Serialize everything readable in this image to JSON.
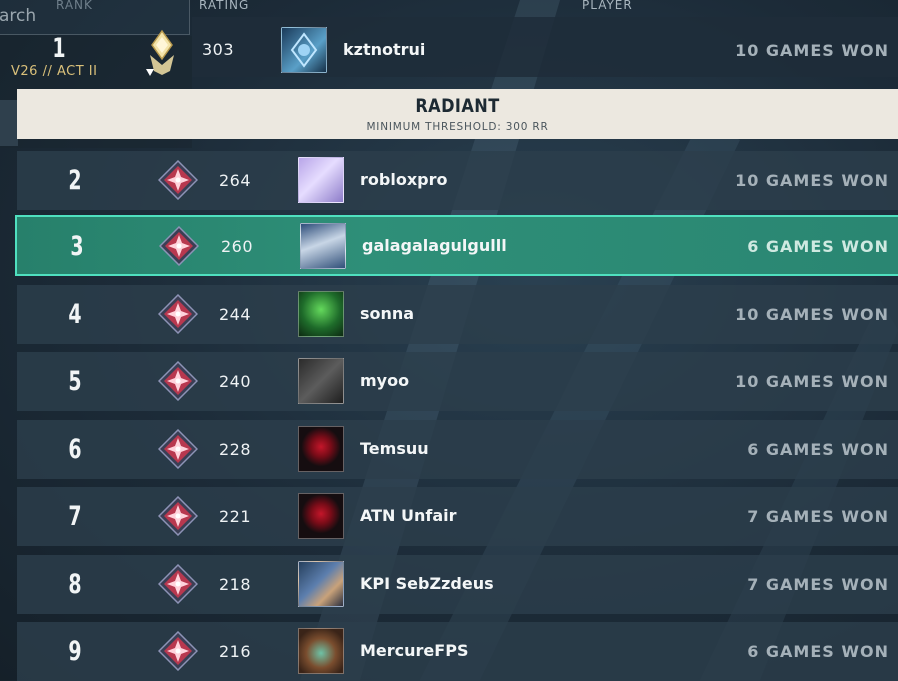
{
  "columns": {
    "rank": "RANK",
    "rating": "RATING",
    "player": "PLAYER"
  },
  "search": {
    "placeholder": "arch"
  },
  "season": "V26 // ACT II",
  "tier_banner": {
    "title": "RADIANT",
    "subtitle": "MINIMUM THRESHOLD: 300 RR"
  },
  "colors": {
    "selected_row": "#2e8f78",
    "selected_border": "#4fe0bf",
    "banner": "#ece8e0",
    "row": "#2c3e4c"
  },
  "rows": [
    {
      "rank": "1",
      "rating": "303",
      "name": "kztnotrui",
      "games": "10 GAMES WON",
      "tier_icon": "radiant-rank-icon",
      "avatar": "card-blue-emblem"
    },
    {
      "rank": "2",
      "rating": "264",
      "name": "robloxpro",
      "games": "10 GAMES WON",
      "tier_icon": "immortal-rank-icon",
      "avatar": "card-lilac-figure"
    },
    {
      "rank": "3",
      "rating": "260",
      "name": "galagalagulgulll",
      "games": "6 GAMES WON",
      "tier_icon": "immortal-rank-icon",
      "avatar": "card-white-hair-agent",
      "selected": true
    },
    {
      "rank": "4",
      "rating": "244",
      "name": "sonna",
      "games": "10 GAMES WON",
      "tier_icon": "immortal-rank-icon",
      "avatar": "card-green-silhouette"
    },
    {
      "rank": "5",
      "rating": "240",
      "name": "myoo",
      "games": "10 GAMES WON",
      "tier_icon": "immortal-rank-icon",
      "avatar": "card-grey-logo"
    },
    {
      "rank": "6",
      "rating": "228",
      "name": "Temsuu",
      "games": "6 GAMES WON",
      "tier_icon": "immortal-rank-icon",
      "avatar": "card-red-rose"
    },
    {
      "rank": "7",
      "rating": "221",
      "name": "ATN Unfair",
      "games": "7 GAMES WON",
      "tier_icon": "immortal-rank-icon",
      "avatar": "card-red-rose"
    },
    {
      "rank": "8",
      "rating": "218",
      "name": "KPI SebZzdeus",
      "games": "7 GAMES WON",
      "tier_icon": "immortal-rank-icon",
      "avatar": "card-blue-hair-agent"
    },
    {
      "rank": "9",
      "rating": "216",
      "name": "MercureFPS",
      "games": "6 GAMES WON",
      "tier_icon": "immortal-rank-icon",
      "avatar": "card-brown-hair-agent"
    }
  ]
}
